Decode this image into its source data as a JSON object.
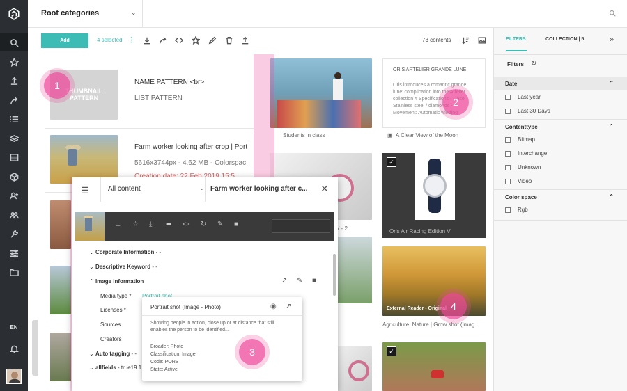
{
  "topbar": {
    "category_select": "Root categories",
    "search_icon": "search-icon"
  },
  "rail": {
    "items": [
      "search-icon",
      "star-icon",
      "upload-icon",
      "share-icon",
      "list-icon",
      "layers-icon",
      "table-icon",
      "cube-icon",
      "user-add-icon",
      "users-icon",
      "wrench-icon",
      "sliders-icon",
      "folder-icon"
    ],
    "lang": "EN",
    "bell_icon": "bell-icon"
  },
  "toolbar": {
    "add_label": "Add",
    "selected_label": "4 selected",
    "contents_count": "73 contents"
  },
  "list": {
    "row1": {
      "thumb_text": "THUMBNAIL PATTERN",
      "name_pattern": "NAME PATTERN <br>",
      "list_pattern": "LIST PATTERN"
    },
    "row2": {
      "title": "Farm worker looking after crop | Port",
      "meta": "5616x3744px - 4.62 MB - Colorspac",
      "date": "Creation date: 22 Feb 2019 15:5 ..."
    }
  },
  "grid": {
    "card1_title": "Students in class",
    "card2_title": "ORIS ARTELIER GRANDE LUNE",
    "card2_body": "Oris introduces a romantic grande lune' complication into the Arteller collection # Specifications - Case: Stainless steel / diamonds - Movement: Automatic winding",
    "card2_caption": "A Clear View of the Moon",
    "card3_caption": "V - 2",
    "card4_caption": "Oris Air Racing Edition V",
    "card5_overlay": "External Reader - Original",
    "card5_caption": "Agriculture, Nature | Grow shot (Imag..."
  },
  "filters": {
    "tab_filters": "FILTERS",
    "tab_collection": "COLLECTION | 5",
    "filters_label": "Filters",
    "sections": [
      {
        "title": "Date",
        "items": [
          "Last year",
          "Last 30 Days"
        ]
      },
      {
        "title": "Contenttype",
        "items": [
          "Bitmap",
          "Interchange",
          "Unknown",
          "Video"
        ]
      },
      {
        "title": "Color space",
        "items": [
          "Rgb"
        ]
      }
    ]
  },
  "overlay": {
    "select_value": "All content",
    "title": "Farm worker looking after c...",
    "tree": {
      "corporate": "Corporate Information",
      "corporate_val": "- -",
      "descriptive": "Descriptive Keyword",
      "descriptive_val": "- -",
      "image_info": "Image information",
      "media_type": "Media type *",
      "media_type_val": "Portrait shot",
      "licenses": "Licenses *",
      "sources": "Sources",
      "creators": "Creators",
      "auto_tagging": "Auto tagging",
      "auto_tagging_val": "- -",
      "allfields": "allfields",
      "allfields_val": "- true19.1:"
    },
    "popup": {
      "title": "Portrait shot (Image - Photo)",
      "desc": "Showing people in action, close up or at distance that still enables the person to be identified...",
      "broader": "Broader: Photo",
      "classification": "Classification: Image",
      "code": "Code: PORS",
      "state": "State: Active"
    }
  },
  "markers": [
    "1",
    "2",
    "3",
    "4"
  ],
  "colors": {
    "accent": "#3cbcb4",
    "rail": "#2b2f33",
    "pink": "#ec4899"
  }
}
